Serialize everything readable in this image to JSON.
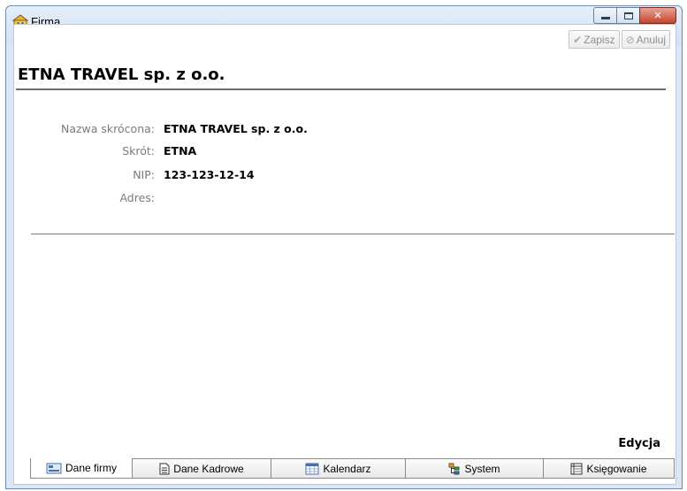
{
  "window": {
    "title": "Firma",
    "icons": {
      "app": "yellow-building-icon",
      "minimize": "minimize-icon",
      "maximize": "maximize-icon",
      "close": "close-icon"
    }
  },
  "toolbar": {
    "save_label": "Zapisz",
    "save_icon": "checkmark-icon",
    "cancel_label": "Anuluj",
    "cancel_icon": "cancel-circle-icon",
    "save_enabled": false,
    "cancel_enabled": false
  },
  "company": {
    "title": "ETNA TRAVEL sp. z o.o.",
    "fields": [
      {
        "label": "Nazwa skrócona:",
        "value": "ETNA TRAVEL sp. z o.o."
      },
      {
        "label": "Skrót:",
        "value": "ETNA"
      },
      {
        "label": "NIP:",
        "value": "123-123-12-14"
      },
      {
        "label": "Adres:",
        "value": ""
      }
    ]
  },
  "mode_label": "Edycja",
  "tabs": [
    {
      "label": "Dane firmy",
      "icon": "company-data-icon",
      "active": true
    },
    {
      "label": "Dane Kadrowe",
      "icon": "document-icon",
      "active": false
    },
    {
      "label": "Kalendarz",
      "icon": "calendar-icon",
      "active": false
    },
    {
      "label": "System",
      "icon": "system-tree-icon",
      "active": false
    },
    {
      "label": "Księgowanie",
      "icon": "ledger-icon",
      "active": false
    }
  ],
  "colors": {
    "titlebar": "#d3e1f3",
    "close_button": "#c6452d",
    "label_gray": "#7a7a7a",
    "disabled_text": "#8e8e8e"
  }
}
